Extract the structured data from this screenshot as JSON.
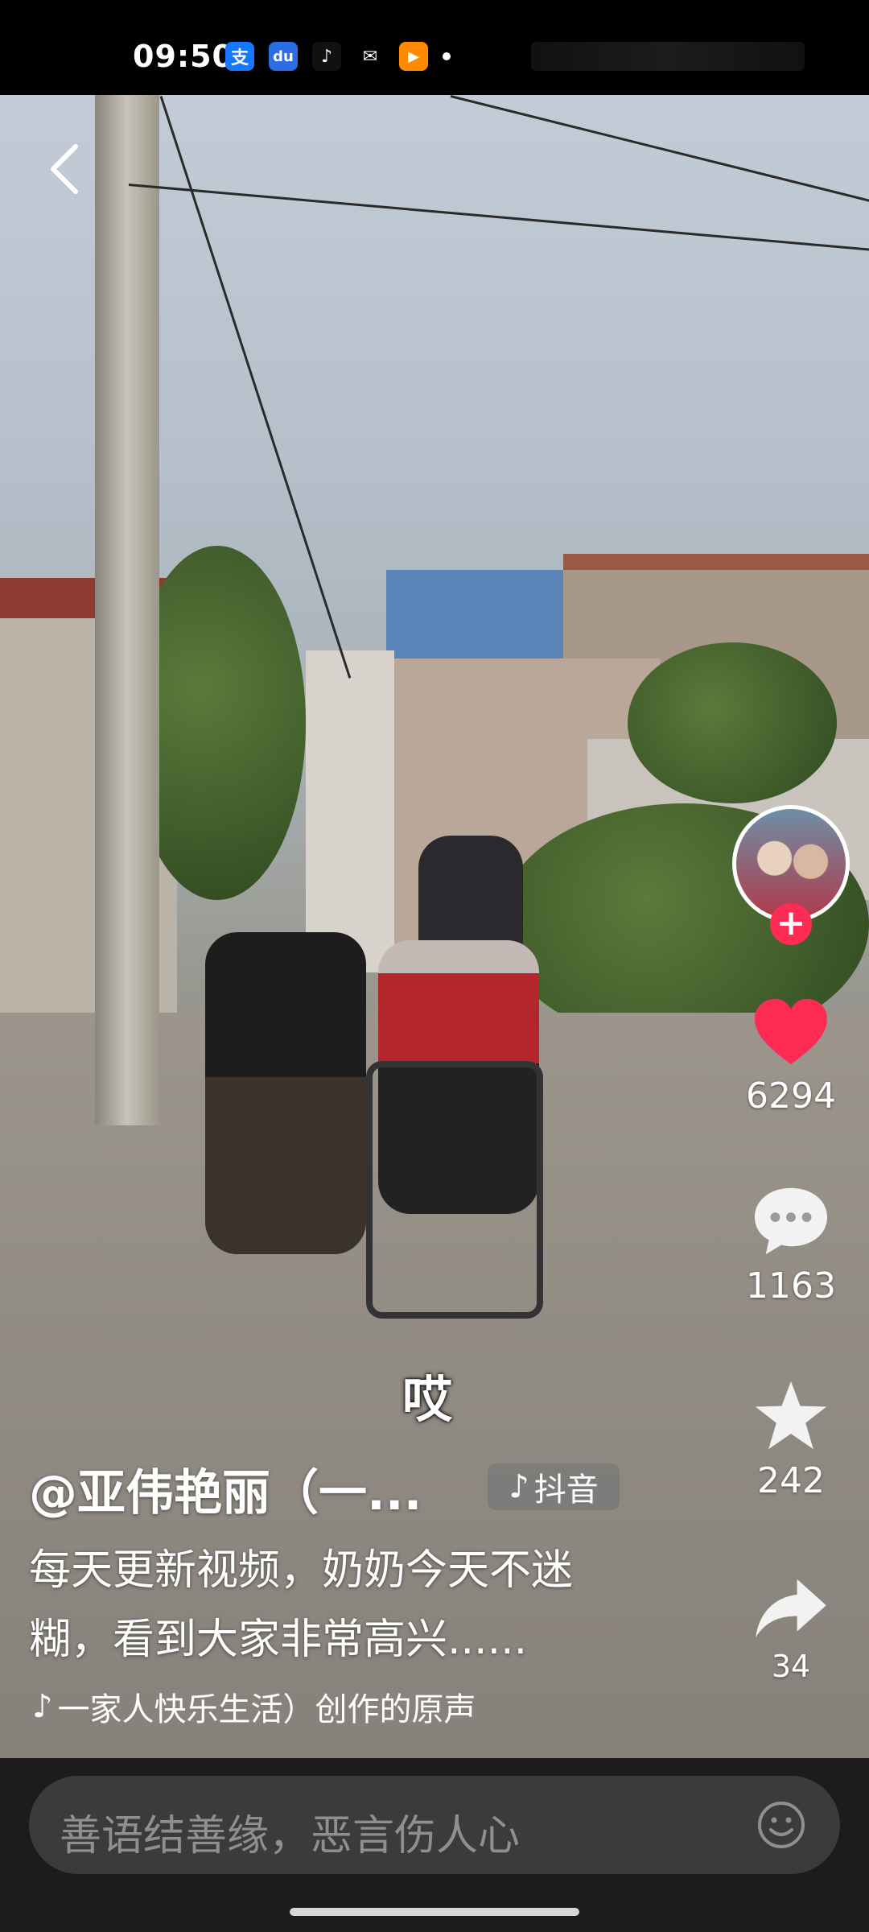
{
  "status_bar": {
    "time": "09:50",
    "app_icons": [
      {
        "name": "alipay-icon",
        "glyph": "支",
        "color": "#1677ff"
      },
      {
        "name": "baidu-icon",
        "glyph": "du",
        "color": "#2b6de5"
      },
      {
        "name": "tiktok-icon",
        "glyph": "♪",
        "color": "#111111"
      },
      {
        "name": "wechat-icon",
        "glyph": "✉",
        "color": "#000000"
      },
      {
        "name": "video-app-icon",
        "glyph": "▶",
        "color": "#ff8a00"
      }
    ]
  },
  "video": {
    "subtitle": "哎"
  },
  "rail": {
    "like_count": "6294",
    "comment_count": "1163",
    "favorite_count": "242",
    "share_count": "34",
    "like_color": "#fe2c55"
  },
  "info": {
    "author": "@亚伟艳丽（一...",
    "platform_tag": "抖音",
    "description": "每天更新视频，奶奶今天不迷糊，看到大家非常高兴......",
    "music": "一家人快乐生活）创作的原声"
  },
  "comment": {
    "placeholder": "善语结善缘，恶言伤人心"
  }
}
